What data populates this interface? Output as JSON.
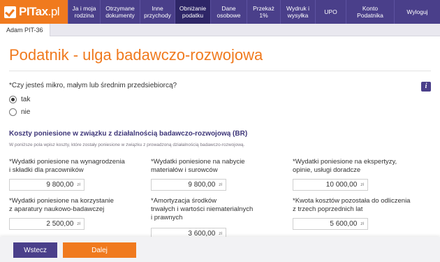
{
  "logo": {
    "bold": "PITax",
    "light": ".pl"
  },
  "nav": [
    {
      "label": "Ja i moja rodzina",
      "active": false
    },
    {
      "label": "Otrzymane dokumenty",
      "active": false
    },
    {
      "label": "Inne przychody",
      "active": false
    },
    {
      "label": "Obniżanie podatku",
      "active": true
    },
    {
      "label": "Dane osobowe",
      "active": false
    },
    {
      "label": "Przekaż 1%",
      "active": false
    },
    {
      "label": "Wydruk i wysyłka",
      "active": false
    },
    {
      "label": "UPO",
      "active": false
    },
    {
      "label": "Konto Podatnika",
      "active": false
    },
    {
      "label": "Wyloguj",
      "active": false
    }
  ],
  "subtab": "Adam PIT-36",
  "page_title": "Podatnik - ulga badawczo-rozwojowa",
  "question": "*Czy jesteś mikro, małym lub średnim przedsiebiorcą?",
  "info_icon": "i",
  "radios": [
    {
      "label": "tak",
      "checked": true
    },
    {
      "label": "nie",
      "checked": false
    }
  ],
  "section": {
    "title": "Koszty poniesione w związku z działalnością badawczo-rozwojową (BR)",
    "desc": "W poniższe pola wpisz koszty, które zostały poniesione w związku z prowadzoną działalnością badawczo-rozwojową."
  },
  "currency": "zł",
  "fields": [
    {
      "label_lines": [
        "*Wydatki poniesione na wynagrodzenia",
        "i składki dla pracowników"
      ],
      "value": "9 800,00"
    },
    {
      "label_lines": [
        "*Wydatki poniesione na nabycie",
        "materiałów i surowców"
      ],
      "value": "9 800,00"
    },
    {
      "label_lines": [
        "*Wydatki poniesione na ekspertyzy,",
        "opinie, usługi doradcze"
      ],
      "value": "10 000,00"
    },
    {
      "label_lines": [
        "*Wydatki poniesione na korzystanie",
        "z aparatury naukowo-badawczej"
      ],
      "value": "2 500,00"
    },
    {
      "label_lines": [
        "*Amortyzacja środków",
        "trwałych i wartości niematerialnych",
        "i prawnych"
      ],
      "value": "3 600,00"
    },
    {
      "label_lines": [
        "*Kwota kosztów pozostała do odliczenia",
        "z trzech poprzednich lat"
      ],
      "value": "5 600,00"
    }
  ],
  "buttons": {
    "back": "Wstecz",
    "next": "Dalej"
  },
  "colors": {
    "brand_orange": "#f07a1e",
    "nav_purple": "#4a3f8a",
    "nav_active": "#2e2667"
  }
}
